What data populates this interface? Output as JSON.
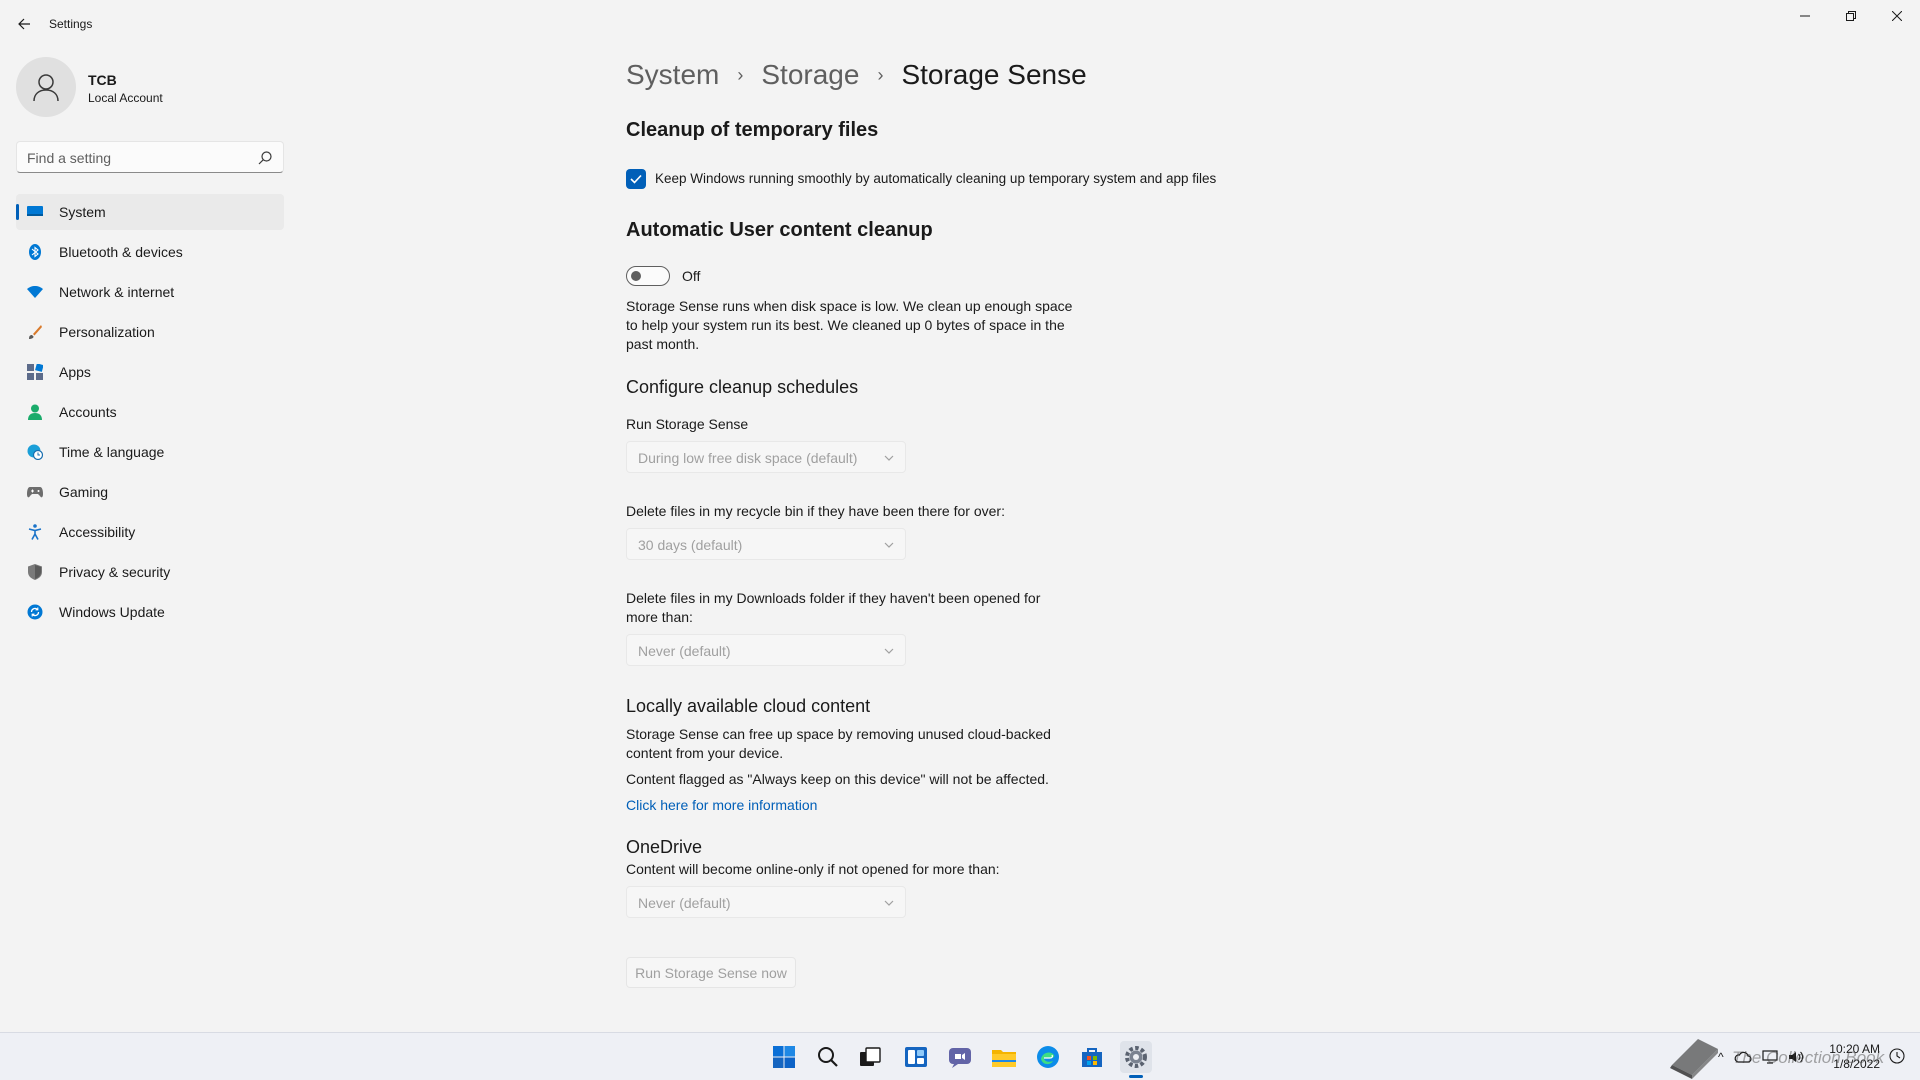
{
  "window": {
    "title": "Settings",
    "controls": [
      "minimize-icon",
      "restore-icon",
      "close-icon"
    ]
  },
  "profile": {
    "name": "TCB",
    "account_type": "Local Account"
  },
  "search": {
    "placeholder": "Find a setting"
  },
  "sidebar": {
    "items": [
      {
        "label": "System",
        "icon": "system-icon",
        "active": true
      },
      {
        "label": "Bluetooth & devices",
        "icon": "bluetooth-icon"
      },
      {
        "label": "Network & internet",
        "icon": "network-icon"
      },
      {
        "label": "Personalization",
        "icon": "brush-icon"
      },
      {
        "label": "Apps",
        "icon": "apps-icon"
      },
      {
        "label": "Accounts",
        "icon": "person-icon"
      },
      {
        "label": "Time & language",
        "icon": "globe-clock-icon"
      },
      {
        "label": "Gaming",
        "icon": "controller-icon"
      },
      {
        "label": "Accessibility",
        "icon": "accessibility-icon"
      },
      {
        "label": "Privacy & security",
        "icon": "shield-icon"
      },
      {
        "label": "Windows Update",
        "icon": "update-icon"
      }
    ]
  },
  "breadcrumb": {
    "items": [
      "System",
      "Storage"
    ],
    "current": "Storage Sense"
  },
  "cleanup": {
    "title": "Cleanup of temporary files",
    "checkbox_label": "Keep Windows running smoothly by automatically cleaning up temporary system and app files",
    "checked": true
  },
  "auto_cleanup": {
    "title": "Automatic User content cleanup",
    "toggle_label": "Off",
    "toggle_on": false,
    "description": "Storage Sense runs when disk space is low. We clean up enough space to help your system run its best. We cleaned up 0 bytes of space in the past month."
  },
  "schedules": {
    "title": "Configure cleanup schedules",
    "run_label": "Run Storage Sense",
    "run_value": "During low free disk space (default)",
    "recycle_label": "Delete files in my recycle bin if they have been there for over:",
    "recycle_value": "30 days (default)",
    "downloads_label": "Delete files in my Downloads folder if they haven't been opened for more than:",
    "downloads_value": "Never (default)"
  },
  "cloud": {
    "title": "Locally available cloud content",
    "description": "Storage Sense can free up space by removing unused cloud-backed content from your device.",
    "note": "Content flagged as \"Always keep on this device\" will not be affected.",
    "link": "Click here for more information"
  },
  "onedrive": {
    "title": "OneDrive",
    "label": "Content will become online-only if not opened for more than:",
    "value": "Never (default)"
  },
  "run_now_button": "Run Storage Sense now",
  "taskbar": {
    "apps": [
      "start-icon",
      "search-icon",
      "task-view-icon",
      "widgets-icon",
      "chat-icon",
      "file-explorer-icon",
      "edge-icon",
      "store-icon",
      "settings-icon"
    ],
    "active_app": "settings-icon",
    "time": "10:20 AM",
    "date": "1/8/2022"
  },
  "watermark": {
    "text": "The Collection Book"
  },
  "colors": {
    "accent": "#005fb8",
    "background": "#f3f3f3",
    "disabled_text": "#a0a0a0"
  }
}
